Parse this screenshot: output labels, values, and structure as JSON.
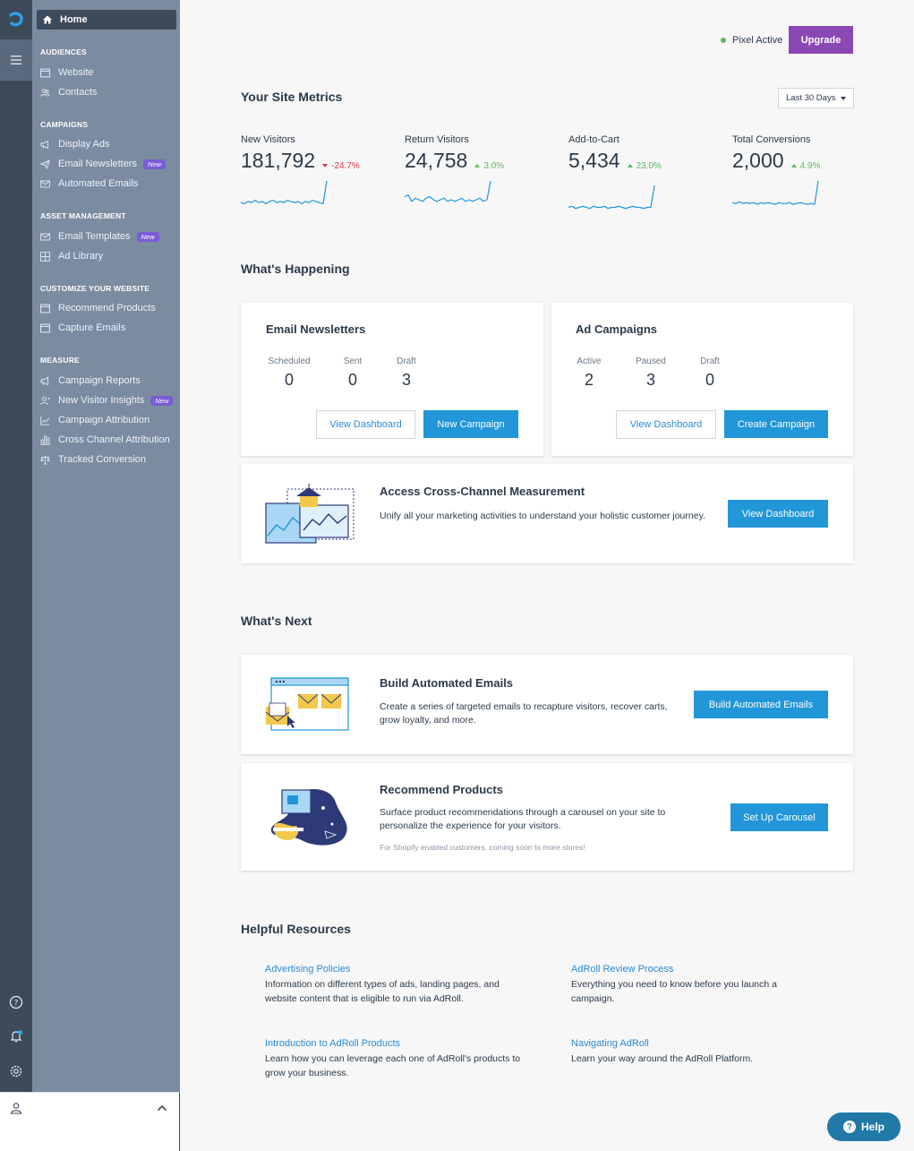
{
  "sidebar": {
    "home_label": "Home",
    "sections": [
      {
        "title": "AUDIENCES",
        "items": [
          {
            "label": "Website",
            "icon": "browser-icon",
            "new": false
          },
          {
            "label": "Contacts",
            "icon": "users-icon",
            "new": false
          }
        ]
      },
      {
        "title": "CAMPAIGNS",
        "items": [
          {
            "label": "Display Ads",
            "icon": "megaphone-icon",
            "new": false
          },
          {
            "label": "Email Newsletters",
            "icon": "paper-plane-icon",
            "new": true
          },
          {
            "label": "Automated Emails",
            "icon": "envelope-icon",
            "new": false
          }
        ]
      },
      {
        "title": "ASSET MANAGEMENT",
        "items": [
          {
            "label": "Email Templates",
            "icon": "envelope-icon",
            "new": true
          },
          {
            "label": "Ad Library",
            "icon": "grid-icon",
            "new": false
          }
        ]
      },
      {
        "title": "CUSTOMIZE YOUR WEBSITE",
        "items": [
          {
            "label": "Recommend Products",
            "icon": "browser-icon",
            "new": false
          },
          {
            "label": "Capture Emails",
            "icon": "browser-icon",
            "new": false
          }
        ]
      },
      {
        "title": "MEASURE",
        "items": [
          {
            "label": "Campaign Reports",
            "icon": "megaphone-icon",
            "new": false
          },
          {
            "label": "New Visitor Insights",
            "icon": "user-icon",
            "new": true
          },
          {
            "label": "Campaign Attribution",
            "icon": "line-chart-icon",
            "new": false
          },
          {
            "label": "Cross Channel Attribution",
            "icon": "bar-chart-icon",
            "new": false
          },
          {
            "label": "Tracked Conversion",
            "icon": "scale-icon",
            "new": false
          }
        ]
      }
    ],
    "new_badge": "New"
  },
  "header": {
    "pixel_status": "Pixel Active",
    "upgrade_label": "Upgrade"
  },
  "metrics": {
    "title": "Your Site Metrics",
    "range": "Last 30 Days",
    "items": [
      {
        "label": "New Visitors",
        "value": "181,792",
        "delta": "-24.7%",
        "trend": "down",
        "spark": [
          3,
          2,
          4,
          3,
          5,
          3,
          4,
          2,
          4,
          5,
          3,
          4,
          3,
          5,
          4,
          3,
          4,
          2,
          4,
          3,
          5,
          4,
          3,
          2,
          22
        ]
      },
      {
        "label": "Return Visitors",
        "value": "24,758",
        "delta": "3.0%",
        "trend": "up",
        "spark": [
          6,
          7,
          3,
          5,
          4,
          3,
          5,
          6,
          4,
          3,
          4,
          5,
          3,
          4,
          3,
          4,
          5,
          3,
          4,
          3,
          4,
          5,
          3,
          4,
          16
        ]
      },
      {
        "label": "Add-to-Cart",
        "value": "5,434",
        "delta": "23.0%",
        "trend": "up",
        "spark": [
          3,
          4,
          2,
          3,
          4,
          3,
          2,
          4,
          3,
          3,
          4,
          2,
          3,
          3,
          4,
          3,
          2,
          3,
          4,
          3,
          3,
          2,
          3,
          3,
          24
        ]
      },
      {
        "label": "Total Conversions",
        "value": "2,000",
        "delta": "4.9%",
        "trend": "up",
        "spark": [
          4,
          3,
          5,
          3,
          4,
          3,
          4,
          2,
          4,
          3,
          4,
          3,
          2,
          4,
          3,
          3,
          4,
          2,
          3,
          4,
          3,
          2,
          3,
          2,
          30
        ]
      }
    ]
  },
  "happening": {
    "title": "What's Happening",
    "email": {
      "title": "Email Newsletters",
      "stats": [
        {
          "label": "Scheduled",
          "value": "0"
        },
        {
          "label": "Sent",
          "value": "0"
        },
        {
          "label": "Draft",
          "value": "3"
        }
      ],
      "view_label": "View Dashboard",
      "action_label": "New Campaign"
    },
    "ads": {
      "title": "Ad Campaigns",
      "stats": [
        {
          "label": "Active",
          "value": "2"
        },
        {
          "label": "Paused",
          "value": "3"
        },
        {
          "label": "Draft",
          "value": "0"
        }
      ],
      "view_label": "View Dashboard",
      "action_label": "Create Campaign"
    },
    "cross": {
      "title": "Access Cross-Channel Measurement",
      "desc": "Unify all your marketing activities to understand your holistic customer journey.",
      "action_label": "View Dashboard"
    }
  },
  "next": {
    "title": "What's Next",
    "auto": {
      "title": "Build Automated Emails",
      "desc": "Create a series of targeted emails to recapture visitors, recover carts, grow loyalty, and more.",
      "action_label": "Build Automated Emails"
    },
    "recommend": {
      "title": "Recommend Products",
      "desc": "Surface product recommendations through a carousel on your site to personalize the experience for your visitors.",
      "note": "For Shopify enabled customers, coming soon to more stores!",
      "action_label": "Set Up Carousel"
    }
  },
  "resources": {
    "title": "Helpful Resources",
    "items": [
      {
        "title": "Advertising Policies",
        "desc": "Information on different types of ads, landing pages, and website content that is eligible to run via AdRoll."
      },
      {
        "title": "AdRoll Review Process",
        "desc": "Everything you need to know before you launch a campaign."
      },
      {
        "title": "Introduction to AdRoll Products",
        "desc": "Learn how you can leverage each one of AdRoll's products to grow your business."
      },
      {
        "title": "Navigating AdRoll",
        "desc": "Learn your way around the AdRoll Platform."
      }
    ]
  },
  "help_label": "Help",
  "colors": {
    "accent": "#2196d9",
    "upgrade": "#8a48b5",
    "positive": "#5cb85c",
    "negative": "#d9363e",
    "sidebar": "#7b8ba0",
    "rail": "#3c4a5a"
  }
}
